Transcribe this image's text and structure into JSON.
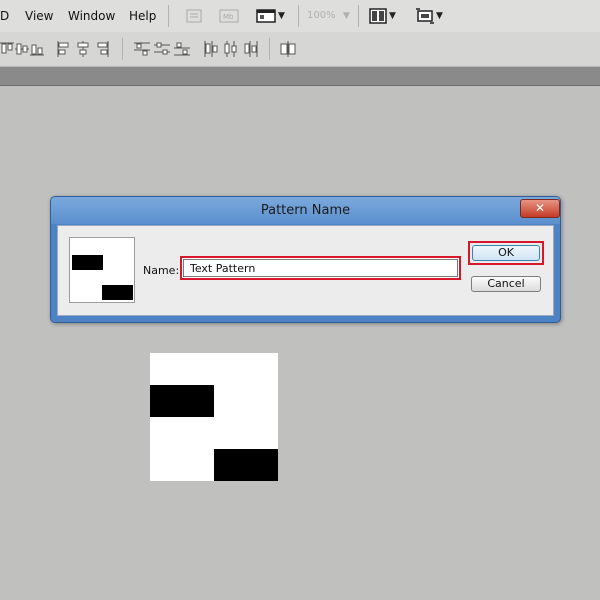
{
  "menu": {
    "items": [
      "D",
      "View",
      "Window",
      "Help"
    ]
  },
  "toolbar": {
    "zoom_label": "100%"
  },
  "icons": {
    "menubar": [
      "bridge-icon",
      "minibridge-icon",
      "screen-mode-icon",
      "arrange-documents-icon",
      "extras-icon"
    ],
    "optionsbar": [
      "align-top-icon",
      "align-vertical-center-icon",
      "align-bottom-icon",
      "align-left-icon",
      "align-horizontal-center-icon",
      "align-right-icon",
      "distribute-top-icon",
      "distribute-vertical-center-icon",
      "distribute-bottom-icon",
      "distribute-left-icon",
      "distribute-horizontal-center-icon",
      "distribute-right-icon",
      "auto-align-icon"
    ]
  },
  "dialog": {
    "title": "Pattern Name",
    "close_glyph": "✕",
    "name_label": "Name:",
    "name_value": "Text Pattern",
    "ok_label": "OK",
    "cancel_label": "Cancel"
  },
  "colors": {
    "highlight": "#d8182a",
    "dialog_frame": "#4d82c4",
    "workspace": "#c0c1bf"
  }
}
